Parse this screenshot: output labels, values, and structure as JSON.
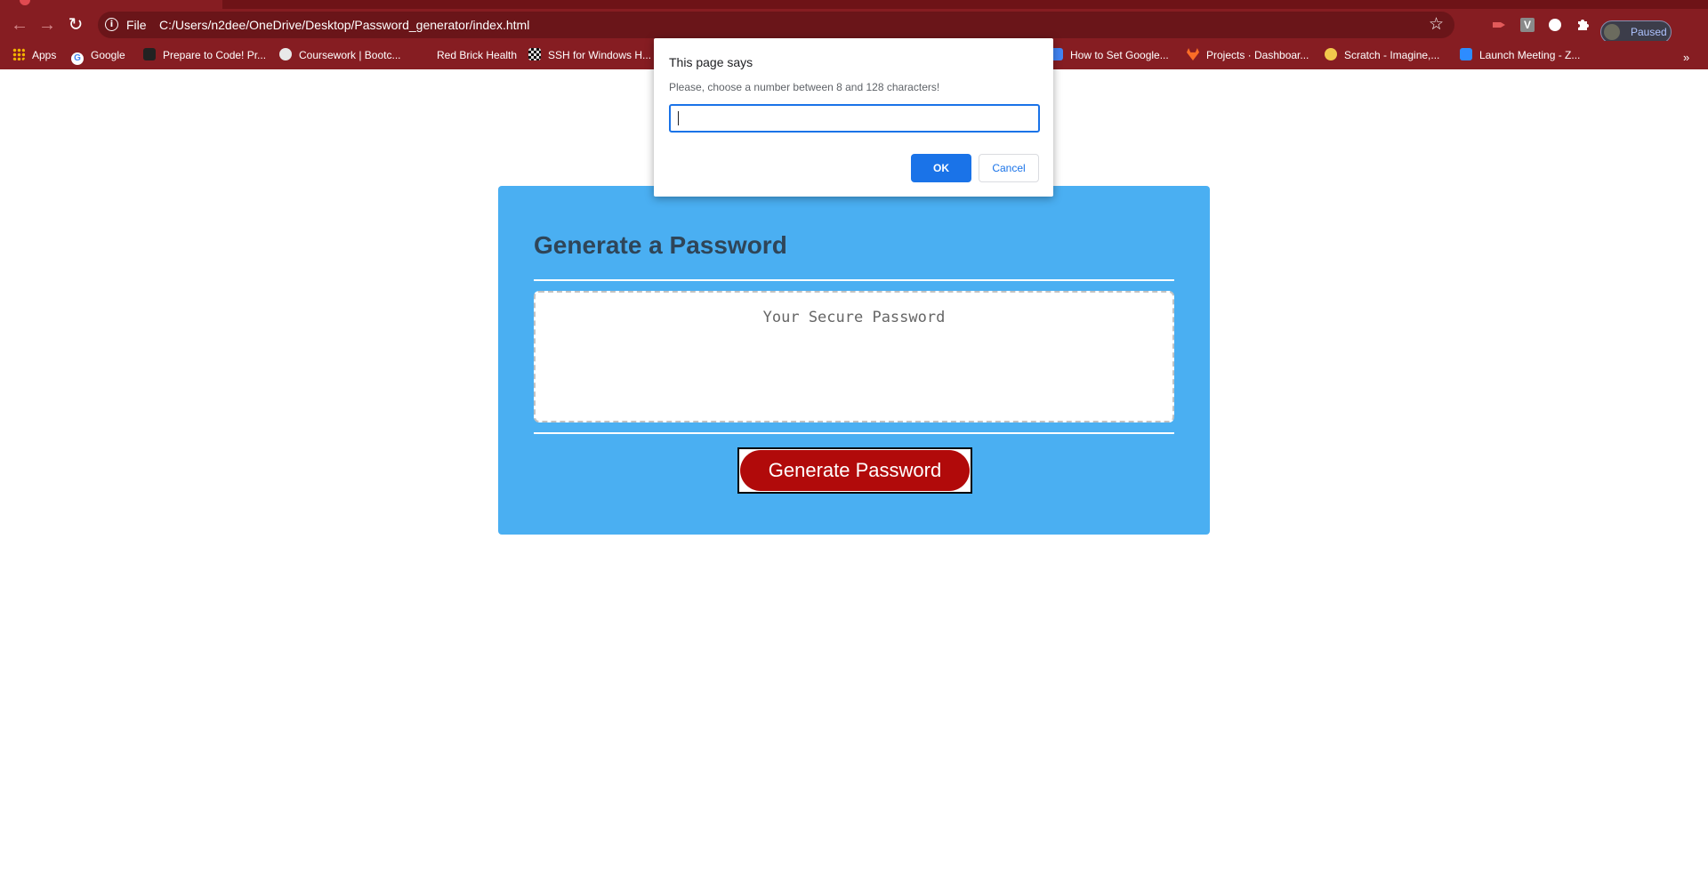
{
  "browser": {
    "address_scheme": "File",
    "url": "C:/Users/n2dee/OneDrive/Desktop/Password_generator/index.html",
    "profile_label": "Paused",
    "theme_color": "#861d22",
    "bookmarks": [
      {
        "label": "Apps",
        "icon": "apps-grid-icon"
      },
      {
        "label": "Google",
        "icon": "google-icon"
      },
      {
        "label": "Prepare to Code! Pr...",
        "icon": "book-icon"
      },
      {
        "label": "Coursework | Bootc...",
        "icon": "globe-icon"
      },
      {
        "label": "Red Brick Health",
        "icon": "blank-icon"
      },
      {
        "label": "SSH for Windows H...",
        "icon": "checker-icon"
      },
      {
        "label": "How to Set Google...",
        "icon": "docs-icon"
      },
      {
        "label": "Projects · Dashboar...",
        "icon": "gitlab-icon"
      },
      {
        "label": "Scratch - Imagine,...",
        "icon": "scratch-icon"
      },
      {
        "label": "Launch Meeting - Z...",
        "icon": "zoom-icon"
      }
    ]
  },
  "page": {
    "title": "Generate a Password",
    "password_placeholder": "Your Secure Password",
    "generate_button_label": "Generate Password",
    "card_color": "#4aaff2",
    "button_color": "#b10a0a"
  },
  "dialog": {
    "origin": "This page says",
    "message": "Please, choose a number between 8 and 128 characters!",
    "input_value": "",
    "ok_label": "OK",
    "cancel_label": "Cancel",
    "accent_color": "#1a73e8"
  }
}
